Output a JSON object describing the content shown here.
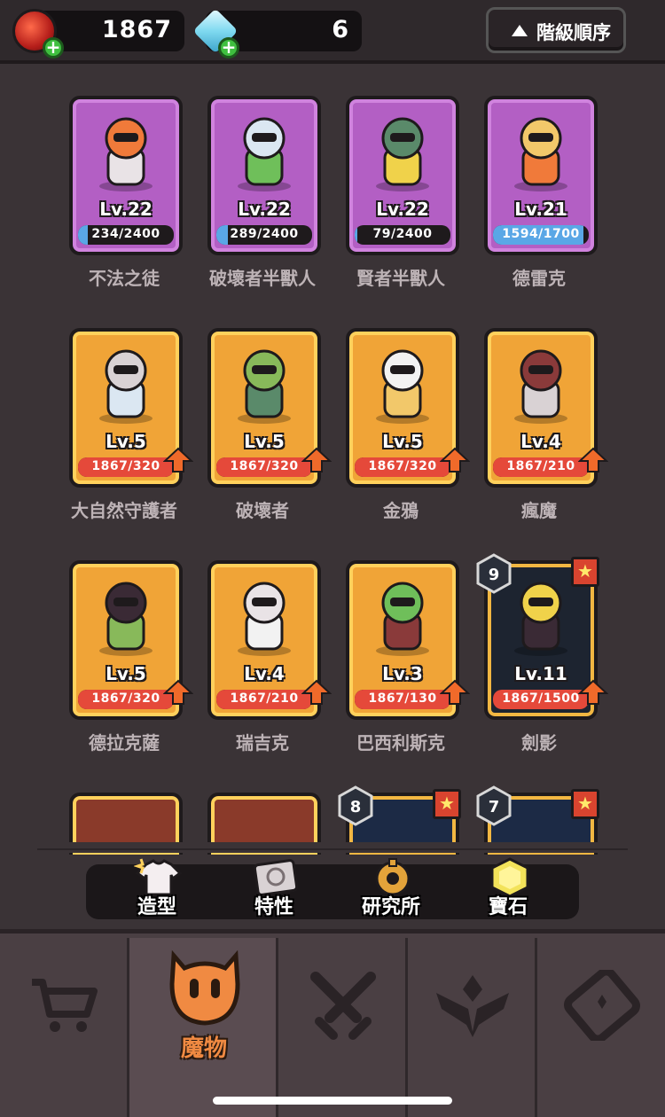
{
  "currency": {
    "red_gem_amount": "1867",
    "crystal_amount": "6"
  },
  "sort_button": {
    "label": "階級順序"
  },
  "monsters": [
    {
      "name": "不法之徒",
      "level": "Lv.22",
      "progress": "234/2400",
      "fill": 0.1,
      "style": "purple",
      "bar_color": "#5aa7e6"
    },
    {
      "name": "破壞者半獸人",
      "level": "Lv.22",
      "progress": "289/2400",
      "fill": 0.12,
      "style": "purple",
      "bar_color": "#5aa7e6"
    },
    {
      "name": "賢者半獸人",
      "level": "Lv.22",
      "progress": "79/2400",
      "fill": 0.03,
      "style": "purple",
      "bar_color": "#5aa7e6"
    },
    {
      "name": "德雷克",
      "level": "Lv.21",
      "progress": "1594/1700",
      "fill": 0.94,
      "style": "purple",
      "bar_color": "#5aa7e6"
    },
    {
      "name": "大自然守護者",
      "level": "Lv.5",
      "progress": "1867/320",
      "fill": 1,
      "style": "gold",
      "bar_color": "#e5493a",
      "upgrade": true
    },
    {
      "name": "破壞者",
      "level": "Lv.5",
      "progress": "1867/320",
      "fill": 1,
      "style": "gold",
      "bar_color": "#e5493a",
      "upgrade": true
    },
    {
      "name": "金鴉",
      "level": "Lv.5",
      "progress": "1867/320",
      "fill": 1,
      "style": "gold",
      "bar_color": "#e5493a",
      "upgrade": true
    },
    {
      "name": "瘋魔",
      "level": "Lv.4",
      "progress": "1867/210",
      "fill": 1,
      "style": "gold",
      "bar_color": "#e5493a",
      "upgrade": true
    },
    {
      "name": "德拉克薩",
      "level": "Lv.5",
      "progress": "1867/320",
      "fill": 1,
      "style": "gold",
      "bar_color": "#e5493a",
      "upgrade": true
    },
    {
      "name": "瑞吉克",
      "level": "Lv.4",
      "progress": "1867/210",
      "fill": 1,
      "style": "gold",
      "bar_color": "#e5493a",
      "upgrade": true
    },
    {
      "name": "巴西利斯克",
      "level": "Lv.3",
      "progress": "1867/130",
      "fill": 1,
      "style": "gold",
      "bar_color": "#e5493a",
      "upgrade": true
    },
    {
      "name": "劍影",
      "level": "Lv.11",
      "progress": "1867/1500",
      "fill": 1,
      "style": "dark",
      "bar_color": "#e5493a",
      "upgrade": true,
      "hex": "9",
      "star": true
    }
  ],
  "partial_row": [
    {
      "style": "darkred"
    },
    {
      "style": "darkred"
    },
    {
      "style": "darkblue",
      "hex": "8",
      "star": true
    },
    {
      "style": "darkblue",
      "hex": "7",
      "star": true
    }
  ],
  "sub_tabs": [
    {
      "label": "造型",
      "icon": "shirt-icon"
    },
    {
      "label": "特性",
      "icon": "scroll-icon"
    },
    {
      "label": "研究所",
      "icon": "gear-icon"
    },
    {
      "label": "寶石",
      "icon": "gem-icon"
    }
  ],
  "bottom_nav": [
    {
      "label": "",
      "icon": "cart-icon"
    },
    {
      "label": "魔物",
      "icon": "monster-face-icon",
      "active": true
    },
    {
      "label": "",
      "icon": "crossed-swords-icon"
    },
    {
      "label": "",
      "icon": "rank-wings-icon"
    },
    {
      "label": "",
      "icon": "ticket-icon"
    }
  ],
  "colors": {
    "background": "#3a3336",
    "purple_card": "#b35fc4",
    "gold_card": "#f0a437",
    "active_tab_accent": "#f08a42"
  }
}
